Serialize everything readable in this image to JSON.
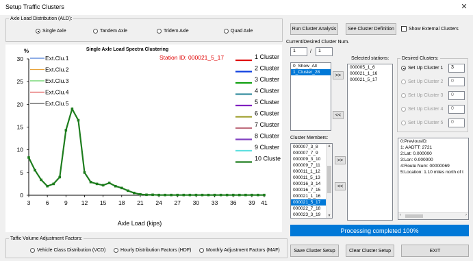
{
  "window": {
    "title": "Setup Traffic Clusters",
    "close_glyph": "✕"
  },
  "ald": {
    "legend": "Axle Load Distribution (ALD):",
    "options": [
      {
        "label": "Single Axle",
        "selected": true
      },
      {
        "label": "Tandem Axle",
        "selected": false
      },
      {
        "label": "Tridem Axle",
        "selected": false
      },
      {
        "label": "Quad Axle",
        "selected": false
      }
    ]
  },
  "toolbar": {
    "run_label": "Run Cluster Analysis",
    "see_label": "See Cluster Definition",
    "show_external_label": "Show External Clusters",
    "show_external_checked": false
  },
  "cluster_num": {
    "label": "Current/Desired Cluster Num.",
    "current": "1",
    "sep": "/",
    "desired": "1"
  },
  "cluster_list": {
    "items": [
      "0_Show_All",
      "1_Cluster_28"
    ],
    "selected": 1
  },
  "selected_stations": {
    "label": "Selected stations:",
    "items": [
      "000005_1_6",
      "000021_1_16",
      "000021_5_17"
    ]
  },
  "move_buttons": {
    "add": ">>",
    "remove": "<<",
    "add2": ">>",
    "remove2": "<<"
  },
  "desired_clusters": {
    "legend": "Desired Clusters:",
    "rows": [
      {
        "label": "Set Up Cluster 1",
        "value": "3",
        "enabled": true,
        "selected": true
      },
      {
        "label": "Set Up Cluster 2",
        "value": "0",
        "enabled": false,
        "selected": false
      },
      {
        "label": "Set Up Cluster 3",
        "value": "0",
        "enabled": false,
        "selected": false
      },
      {
        "label": "Set Up Cluster 4",
        "value": "0",
        "enabled": false,
        "selected": false
      },
      {
        "label": "Set Up Cluster 5",
        "value": "0",
        "enabled": false,
        "selected": false
      }
    ]
  },
  "cluster_members": {
    "label": "Cluster Members:",
    "items": [
      "000007_3_8",
      "000007_7_9",
      "000009_3_10",
      "000009_7_11",
      "000011_1_12",
      "000011_5_13",
      "000016_3_14",
      "000016_7_15",
      "000021_1_16",
      "000021_5_17",
      "000022_7_18",
      "000023_3_19"
    ],
    "selected": 9
  },
  "info": {
    "lines": [
      "0:PreviousID:",
      "1: AADTT: 2721",
      "2:Lat: 0.000000",
      "3:Lon: 0.000000",
      "4:Route Num: 00000069",
      "5:Location: 1.10 miles north of t"
    ]
  },
  "status": {
    "text": "Processing completed 100%",
    "progress": 1.0
  },
  "bottom_buttons": {
    "save": "Save Cluster Setup",
    "clear": "Clear Cluster Setup",
    "exit": "EXIT"
  },
  "tva": {
    "legend": "Taffic Volume Adjustment Factors:",
    "options": [
      {
        "label": "Vehicle Class Distribution (VCD)",
        "selected": false
      },
      {
        "label": "Hourly Distribution Factors (HDF)",
        "selected": false
      },
      {
        "label": "Monthly Adjustment Factors (MAF)",
        "selected": false
      }
    ]
  },
  "chart_data": {
    "type": "line",
    "title": "Single Axle Load Spectra Clustering",
    "station_label": "Station ID: 000021_5_17",
    "ylabel": "%",
    "xlabel": "Axle Load (kips)",
    "ylim": [
      0,
      30
    ],
    "yticks": [
      0,
      5,
      10,
      15,
      20,
      25,
      30
    ],
    "xticks": [
      3,
      6,
      9,
      12,
      15,
      18,
      21,
      24,
      27,
      30,
      33,
      36,
      39,
      41
    ],
    "xlim": [
      3,
      41
    ],
    "grid": false,
    "colors": {
      "main": "#1e7d1e",
      "station_text": "#e00000"
    },
    "series": [
      {
        "name": "Cluster",
        "x": [
          3,
          4,
          5,
          6,
          7,
          8,
          9,
          10,
          11,
          12,
          13,
          14,
          15,
          16,
          17,
          18,
          19,
          20,
          21,
          22,
          23,
          24,
          25,
          26,
          27,
          28,
          29,
          30,
          31,
          32,
          33,
          34,
          35,
          36,
          37,
          38,
          39,
          40,
          41
        ],
        "values": [
          8.3,
          5.5,
          3.4,
          2.0,
          2.5,
          4.0,
          14.3,
          19.0,
          16.5,
          5.0,
          2.9,
          2.5,
          2.2,
          2.7,
          2.0,
          1.6,
          1.0,
          0.5,
          0.2,
          0.1,
          0.1,
          0.05,
          0.05,
          0.05,
          0.05,
          0.05,
          0.05,
          0.05,
          0.05,
          0.05,
          0.05,
          0.05,
          0.05,
          0.05,
          0.05,
          0.05,
          0.05,
          0.05,
          0.05
        ]
      }
    ],
    "legend_left": [
      {
        "name": "Ext.Clu.1",
        "color": "#4a7cd6"
      },
      {
        "name": "Ext.Clu.2",
        "color": "#e8a33a"
      },
      {
        "name": "Ext.Clu.3",
        "color": "#5fd05f"
      },
      {
        "name": "Ext.Clu.4",
        "color": "#e05050"
      },
      {
        "name": "Ext.Clu.5",
        "color": "#505050"
      }
    ],
    "legend_right": [
      {
        "name": "1 Cluster",
        "color": "#e01010"
      },
      {
        "name": "2 Cluster",
        "color": "#1040e0"
      },
      {
        "name": "3 Cluster",
        "color": "#10a010"
      },
      {
        "name": "4 Cluster",
        "color": "#3a8fa0"
      },
      {
        "name": "5 Cluster",
        "color": "#8020c0"
      },
      {
        "name": "6 Cluster",
        "color": "#a0a030"
      },
      {
        "name": "7 Cluster",
        "color": "#c07080"
      },
      {
        "name": "8 Cluster",
        "color": "#8040c0"
      },
      {
        "name": "9 Cluster",
        "color": "#60e0e0"
      },
      {
        "name": "10 Cluste",
        "color": "#1e7d1e"
      }
    ]
  }
}
